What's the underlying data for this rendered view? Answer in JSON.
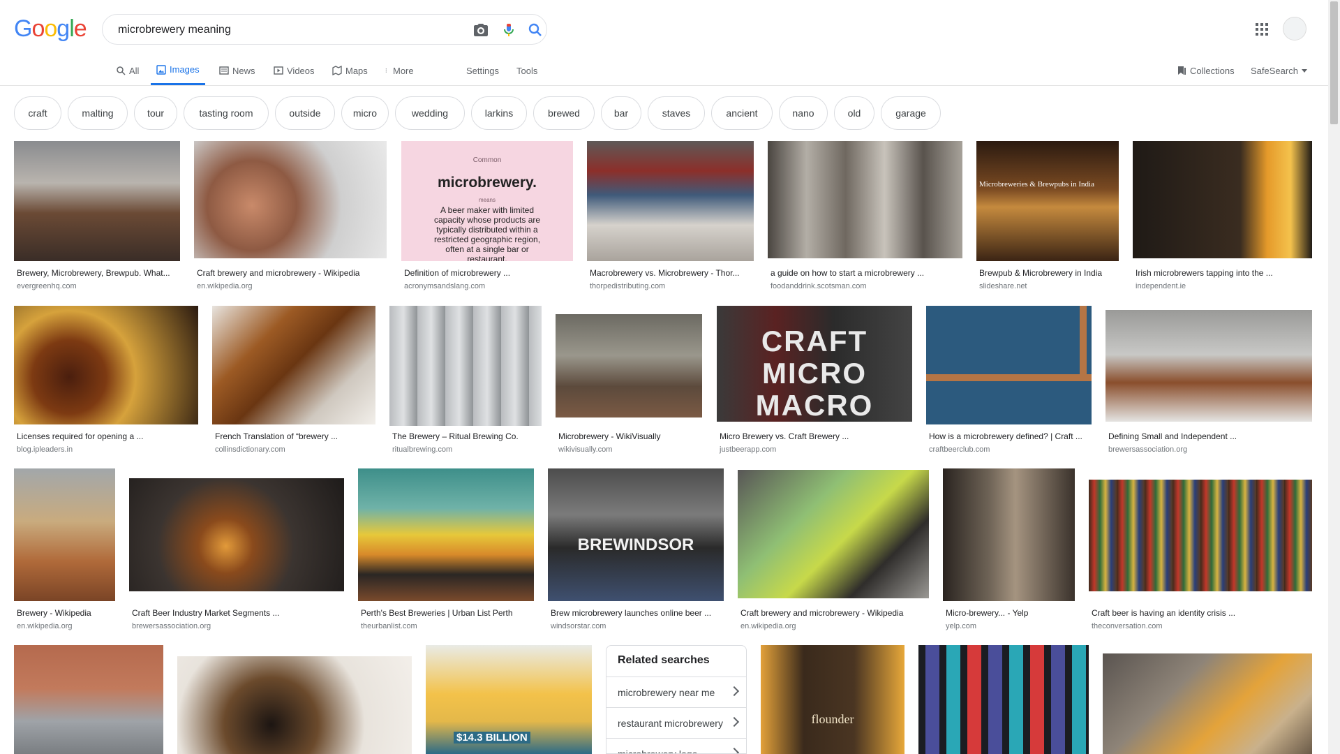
{
  "logo": {
    "text": "Google"
  },
  "search": {
    "query": "microbrewery meaning"
  },
  "tabs": [
    {
      "label": "All"
    },
    {
      "label": "Images"
    },
    {
      "label": "News"
    },
    {
      "label": "Videos"
    },
    {
      "label": "Maps"
    },
    {
      "label": "More"
    },
    {
      "label": "Settings"
    },
    {
      "label": "Tools"
    }
  ],
  "header_right": {
    "collections": "Collections",
    "safesearch": "SafeSearch"
  },
  "chips": [
    "craft",
    "malting",
    "tour",
    "tasting room",
    "outside",
    "micro",
    "wedding",
    "larkins",
    "brewed",
    "bar",
    "staves",
    "ancient",
    "nano",
    "old",
    "garage"
  ],
  "results": [
    {
      "title": "Brewery, Microbrewery, Brewpub. What...",
      "source": "evergreenhq.com"
    },
    {
      "title": "Craft brewery and microbrewery - Wikipedia",
      "source": "en.wikipedia.org"
    },
    {
      "title": "Definition of microbrewery ...",
      "source": "acronymsandslang.com",
      "card": {
        "small": "Common",
        "word": "microbrewery.",
        "means": "means",
        "def": "A beer maker with limited capacity whose products are typically distributed within a restricted geographic region, often at a single bar or restaurant."
      }
    },
    {
      "title": "Macrobrewery vs. Microbrewery - Thor...",
      "source": "thorpedistributing.com"
    },
    {
      "title": "a guide on how to start a microbrewery ...",
      "source": "foodanddrink.scotsman.com"
    },
    {
      "title": "Brewpub & Microbrewery in India",
      "source": "slideshare.net",
      "overlay": "Microbreweries & Brewpubs in India"
    },
    {
      "title": "Irish microbrewers tapping into the ...",
      "source": "independent.ie"
    },
    {
      "title": "Licenses required for opening a ...",
      "source": "blog.ipleaders.in"
    },
    {
      "title": "French Translation of “brewery ...",
      "source": "collinsdictionary.com"
    },
    {
      "title": "The Brewery – Ritual Brewing Co.",
      "source": "ritualbrewing.com"
    },
    {
      "title": "Microbrewery - WikiVisually",
      "source": "wikivisually.com"
    },
    {
      "title": "Micro Brewery vs. Craft Brewery ...",
      "source": "justbeerapp.com",
      "overlay": "CRAFT vs MICRO vs MACRO"
    },
    {
      "title": "How is a microbrewery defined? | Craft ...",
      "source": "craftbeerclub.com"
    },
    {
      "title": "Defining Small and Independent ...",
      "source": "brewersassociation.org"
    },
    {
      "title": "Brewery - Wikipedia",
      "source": "en.wikipedia.org"
    },
    {
      "title": "Craft Beer Industry Market Segments ...",
      "source": "brewersassociation.org"
    },
    {
      "title": "Perth's Best Breweries | Urban List Perth",
      "source": "theurbanlist.com"
    },
    {
      "title": "Brew microbrewery launches online beer ...",
      "source": "windsorstar.com",
      "overlay": "BREWINDSOR"
    },
    {
      "title": "Craft brewery and microbrewery - Wikipedia",
      "source": "en.wikipedia.org"
    },
    {
      "title": "Micro-brewery... - Yelp",
      "source": "yelp.com"
    },
    {
      "title": "Craft beer is having an identity crisis ...",
      "source": "theconversation.com"
    },
    {
      "title": "",
      "source": ""
    },
    {
      "title": "",
      "source": ""
    },
    {
      "title": "",
      "source": "",
      "overlay": "$14.3 BILLION"
    },
    {
      "title": "",
      "source": "",
      "overlay": "flounder"
    },
    {
      "title": "",
      "source": ""
    },
    {
      "title": "",
      "source": ""
    }
  ],
  "related": {
    "title": "Related searches",
    "items": [
      "microbrewery near me",
      "restaurant microbrewery",
      "microbrewery logo"
    ]
  }
}
